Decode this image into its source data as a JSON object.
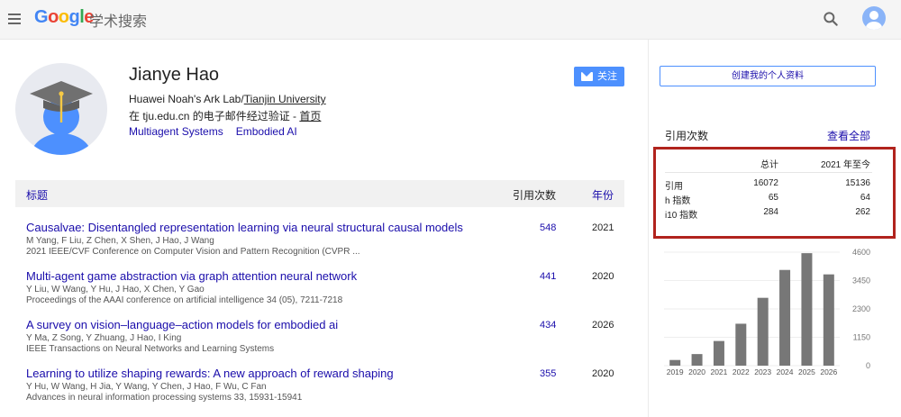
{
  "header": {
    "logo_letters": [
      "G",
      "o",
      "o",
      "g",
      "l",
      "e"
    ],
    "product_name": "学术搜索"
  },
  "profile": {
    "name": "Jianye Hao",
    "affiliation_text": "Huawei Noah's Ark Lab/",
    "affiliation_link": "Tianjin University",
    "email_prefix": "在 tju.edu.cn 的电子邮件经过验证 - ",
    "homepage_link": "首页",
    "interests": [
      "Multiagent Systems",
      "Embodied AI"
    ],
    "follow_label": "关注"
  },
  "articles_table": {
    "col_title": "标题",
    "col_cited_by": "引用次数",
    "col_year": "年份",
    "rows": [
      {
        "title": "Causalvae: Disentangled representation learning via neural structural causal models",
        "authors": "M Yang, F Liu, Z Chen, X Shen, J Hao, J Wang",
        "venue": "2021 IEEE/CVF Conference on Computer Vision and Pattern Recognition (CVPR ...",
        "cited_by": "548",
        "year": "2021"
      },
      {
        "title": "Multi-agent game abstraction via graph attention neural network",
        "authors": "Y Liu, W Wang, Y Hu, J Hao, X Chen, Y Gao",
        "venue": "Proceedings of the AAAI conference on artificial intelligence 34 (05), 7211-7218",
        "cited_by": "441",
        "year": "2020"
      },
      {
        "title": "A survey on vision–language–action models for embodied ai",
        "authors": "Y Ma, Z Song, Y Zhuang, J Hao, I King",
        "venue": "IEEE Transactions on Neural Networks and Learning Systems",
        "cited_by": "434",
        "year": "2026"
      },
      {
        "title": "Learning to utilize shaping rewards: A new approach of reward shaping",
        "authors": "Y Hu, W Wang, H Jia, Y Wang, Y Chen, J Hao, F Wu, C Fan",
        "venue": "Advances in neural information processing systems 33, 15931-15941",
        "cited_by": "355",
        "year": "2020"
      }
    ]
  },
  "sidebar": {
    "create_profile_label": "创建我的个人资料",
    "cited_by_heading": "引用次数",
    "view_all_label": "查看全部",
    "metrics": {
      "header_total": "总计",
      "header_since": "2021 年至今",
      "rows": [
        {
          "label": "引用",
          "total": "16072",
          "since": "15136"
        },
        {
          "label": "h 指数",
          "total": "65",
          "since": "64"
        },
        {
          "label": "i10 指数",
          "total": "284",
          "since": "262"
        }
      ],
      "highlight_color": "#b1231d"
    }
  },
  "chart_data": {
    "type": "bar",
    "categories": [
      "2019",
      "2020",
      "2021",
      "2022",
      "2023",
      "2024",
      "2025",
      "2026"
    ],
    "values": [
      230,
      470,
      1000,
      1700,
      2750,
      3880,
      4560,
      3700
    ],
    "y_ticks": [
      "4600",
      "3450",
      "2300",
      "1150",
      "0"
    ],
    "ylim": [
      0,
      4600
    ],
    "bar_color": "#777777",
    "title": "",
    "xlabel": "",
    "ylabel": ""
  },
  "colors": {
    "link": "#1a0dab",
    "accent_button": "#4d90fe",
    "topbar": "#f5f5f5"
  }
}
